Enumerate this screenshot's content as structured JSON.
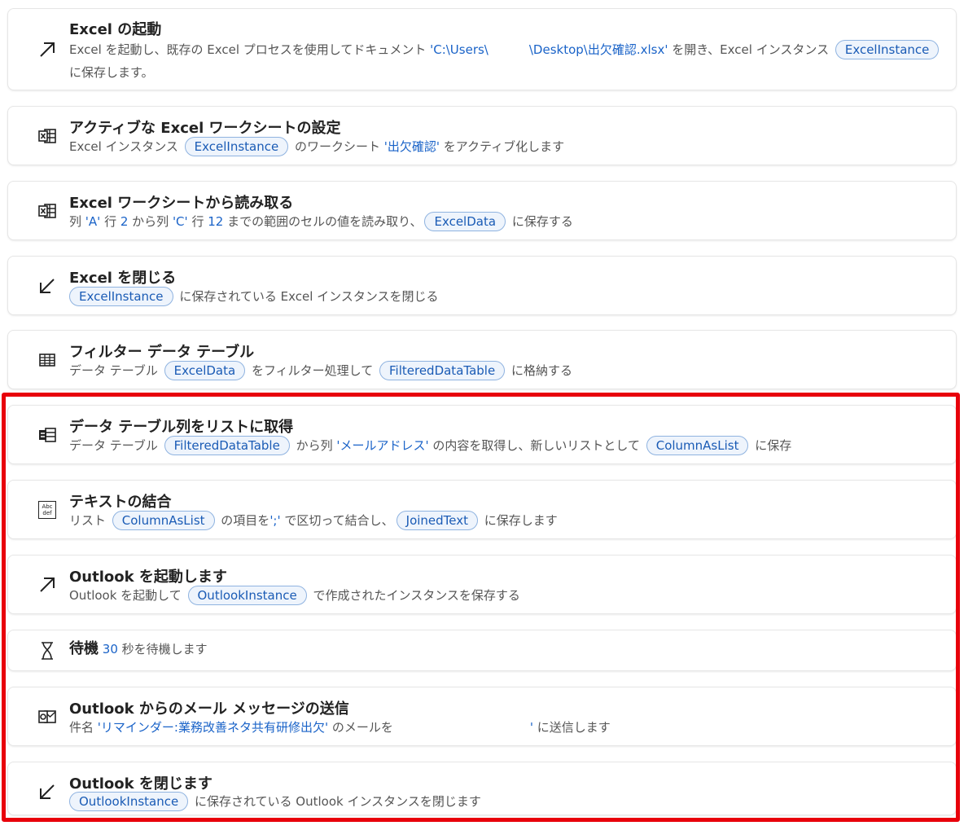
{
  "steps": [
    {
      "icon": "launch-arrow-icon",
      "title": "Excel の起動",
      "desc": {
        "t1": "Excel を起動し、既存の Excel プロセスを使用してドキュメント ",
        "path_a": "'C:\\Users\\",
        "path_b": "\\Desktop\\出欠確認.xlsx'",
        "t2": " を開き、Excel インスタンス ",
        "var1": "ExcelInstance",
        "t3": "に保存します。"
      }
    },
    {
      "icon": "excel-sheet-icon",
      "title": "アクティブな Excel ワークシートの設定",
      "desc": {
        "t1": "Excel インスタンス ",
        "var1": "ExcelInstance",
        "t2": " のワークシート ",
        "val1": "'出欠確認'",
        "t3": " をアクティブ化します"
      }
    },
    {
      "icon": "excel-sheet-icon",
      "title": "Excel ワークシートから読み取る",
      "desc": {
        "t1": "列 ",
        "val1": "'A'",
        "t2": " 行 ",
        "val2": "2",
        "t3": " から列 ",
        "val3": "'C'",
        "t4": " 行 ",
        "val4": "12",
        "t5": " までの範囲のセルの値を読み取り、",
        "var1": "ExcelData",
        "t6": " に保存する"
      }
    },
    {
      "icon": "close-arrow-icon",
      "title": "Excel を閉じる",
      "desc": {
        "var1": "ExcelInstance",
        "t1": " に保存されている Excel インスタンスを閉じる"
      }
    },
    {
      "icon": "table-icon",
      "title": "フィルター データ テーブル",
      "desc": {
        "t1": "データ テーブル ",
        "var1": "ExcelData",
        "t2": " をフィルター処理して ",
        "var2": "FilteredDataTable",
        "t3": " に格納する"
      }
    },
    {
      "icon": "column-to-list-icon",
      "title": "データ テーブル列をリストに取得",
      "desc": {
        "t1": "データ テーブル ",
        "var1": "FilteredDataTable",
        "t2": " から列 ",
        "val1": "'メールアドレス'",
        "t3": " の内容を取得し、新しいリストとして ",
        "var2": "ColumnAsList",
        "t4": " に保存"
      }
    },
    {
      "icon": "text-join-icon",
      "icon_text": "Abc def",
      "title": "テキストの結合",
      "desc": {
        "t1": "リスト ",
        "var1": "ColumnAsList",
        "t2": " の項目を",
        "val1": "';'",
        "t3": " で区切って結合し、",
        "var2": "JoinedText",
        "t4": " に保存します"
      }
    },
    {
      "icon": "launch-arrow-icon",
      "title": "Outlook を起動します",
      "desc": {
        "t1": "Outlook を起動して ",
        "var1": "OutlookInstance",
        "t2": " で作成されたインスタンスを保存する"
      }
    },
    {
      "icon": "hourglass-icon",
      "title": "待機",
      "desc": {
        "val1": "30",
        "t1": " 秒を待機します"
      }
    },
    {
      "icon": "outlook-icon",
      "title": "Outlook からのメール メッセージの送信",
      "desc": {
        "t1": "件名 ",
        "val1": "'リマインダー:業務改善ネタ共有研修出欠'",
        "t2": " のメールを",
        "val2": "'",
        "t3": " に送信します"
      }
    },
    {
      "icon": "close-arrow-icon",
      "title": "Outlook を閉じます",
      "desc": {
        "var1": "OutlookInstance",
        "t1": " に保存されている Outlook インスタンスを閉じます"
      }
    }
  ],
  "highlight_color": "#e8000b"
}
